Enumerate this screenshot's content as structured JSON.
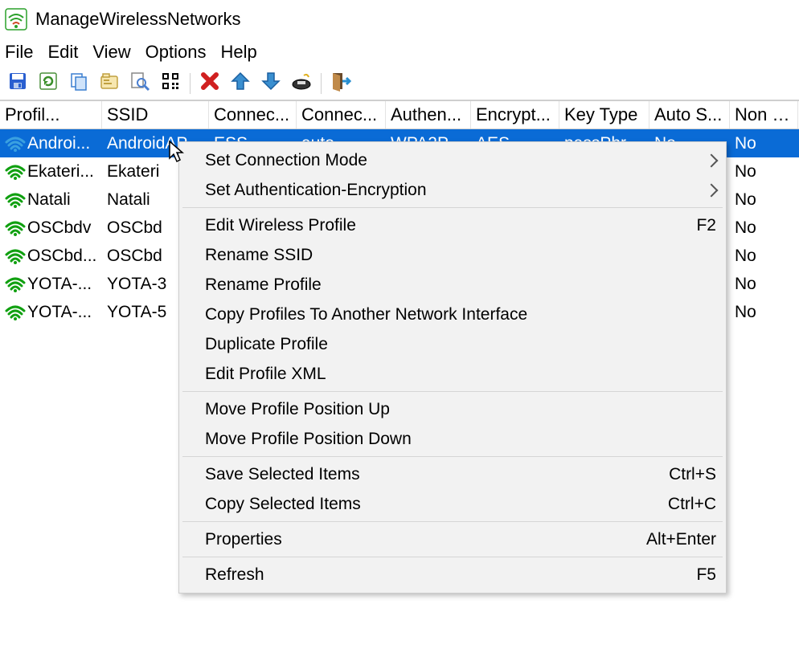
{
  "title": "ManageWirelessNetworks",
  "menu": {
    "file": "File",
    "edit": "Edit",
    "view": "View",
    "options": "Options",
    "help": "Help"
  },
  "toolbar_icons": [
    "save-icon",
    "refresh-icon",
    "copy-icon",
    "properties-icon",
    "find-icon",
    "qr-icon",
    "sep",
    "delete-icon",
    "move-up-icon",
    "move-down-icon",
    "network-icon",
    "sep",
    "exit-icon"
  ],
  "columns": [
    "Profil...",
    "SSID",
    "Connec...",
    "Connec...",
    "Authen...",
    "Encrypt...",
    "Key Type",
    "Auto S...",
    "Non B..."
  ],
  "rows": [
    {
      "selected": true,
      "profile": "Androi...",
      "ssid": "AndroidAP",
      "conn_type": "ESS",
      "conn_mode": "auto",
      "auth": "WPA2P...",
      "encrypt": "AES",
      "key": "passPhr...",
      "auto": "No",
      "nonb": "No"
    },
    {
      "selected": false,
      "profile": "Ekateri...",
      "ssid": "Ekateri",
      "conn_type": "",
      "conn_mode": "",
      "auth": "",
      "encrypt": "",
      "key": "",
      "auto": "",
      "nonb": "No"
    },
    {
      "selected": false,
      "profile": "Natali",
      "ssid": "Natali",
      "conn_type": "",
      "conn_mode": "",
      "auth": "",
      "encrypt": "",
      "key": "",
      "auto": "",
      "nonb": "No"
    },
    {
      "selected": false,
      "profile": "OSCbdv",
      "ssid": "OSCbd",
      "conn_type": "",
      "conn_mode": "",
      "auth": "",
      "encrypt": "",
      "key": "",
      "auto": "",
      "nonb": "No"
    },
    {
      "selected": false,
      "profile": "OSCbd...",
      "ssid": "OSCbd",
      "conn_type": "",
      "conn_mode": "",
      "auth": "",
      "encrypt": "",
      "key": "",
      "auto": "",
      "nonb": "No"
    },
    {
      "selected": false,
      "profile": "YOTA-...",
      "ssid": "YOTA-3",
      "conn_type": "",
      "conn_mode": "",
      "auth": "",
      "encrypt": "",
      "key": "",
      "auto": "",
      "nonb": "No"
    },
    {
      "selected": false,
      "profile": "YOTA-...",
      "ssid": "YOTA-5",
      "conn_type": "",
      "conn_mode": "",
      "auth": "",
      "encrypt": "",
      "key": "",
      "auto": "",
      "nonb": "No"
    }
  ],
  "context_menu": [
    {
      "label": "Set Connection Mode",
      "submenu": true
    },
    {
      "label": "Set Authentication-Encryption",
      "submenu": true
    },
    {
      "sep": true
    },
    {
      "label": "Edit Wireless Profile",
      "shortcut": "F2"
    },
    {
      "label": "Rename SSID"
    },
    {
      "label": "Rename Profile"
    },
    {
      "label": "Copy Profiles To Another Network Interface"
    },
    {
      "label": "Duplicate Profile"
    },
    {
      "label": "Edit Profile XML"
    },
    {
      "sep": true
    },
    {
      "label": "Move Profile Position Up"
    },
    {
      "label": "Move Profile Position Down"
    },
    {
      "sep": true
    },
    {
      "label": "Save Selected Items",
      "shortcut": "Ctrl+S"
    },
    {
      "label": "Copy Selected Items",
      "shortcut": "Ctrl+C"
    },
    {
      "sep": true
    },
    {
      "label": "Properties",
      "shortcut": "Alt+Enter"
    },
    {
      "sep": true
    },
    {
      "label": "Refresh",
      "shortcut": "F5"
    }
  ]
}
